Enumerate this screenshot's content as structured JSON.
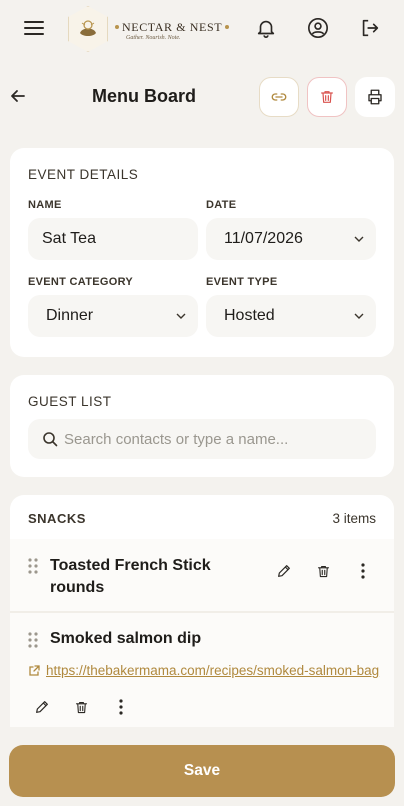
{
  "app": {
    "brand_name": "NECTAR & NEST",
    "brand_tagline": "Gather. Nourish. Note."
  },
  "header": {
    "title": "Menu Board"
  },
  "event_details": {
    "section_title": "EVENT DETAILS",
    "name_label": "NAME",
    "name_value": "Sat Tea",
    "date_label": "DATE",
    "date_value": "11/07/2026",
    "category_label": "EVENT CATEGORY",
    "category_value": "Dinner",
    "type_label": "EVENT TYPE",
    "type_value": "Hosted"
  },
  "guest_list": {
    "section_title": "GUEST LIST",
    "search_placeholder": "Search contacts or type a name..."
  },
  "snacks": {
    "section_title": "SNACKS",
    "count_label": "3 items",
    "items": [
      {
        "name_line1": "Toasted French Stick",
        "name_line2": "rounds"
      },
      {
        "name_line1": "Smoked salmon dip",
        "link": "https://thebakermama.com/recipes/smoked-salmon-bag"
      }
    ]
  },
  "footer": {
    "save_label": "Save"
  },
  "colors": {
    "accent": "#b79050",
    "danger": "#d9534f",
    "background": "#f4f2ee"
  }
}
